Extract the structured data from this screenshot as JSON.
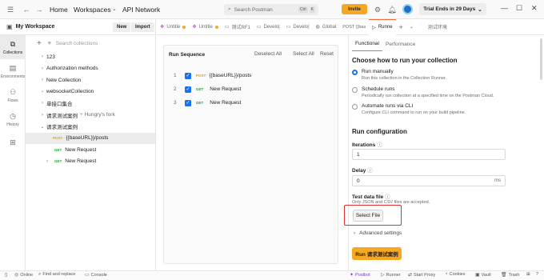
{
  "topbar": {
    "home": "Home",
    "workspaces": "Workspaces",
    "api_network": "API Network",
    "search_placeholder": "Search Postman",
    "kbd_ctrl": "Ctrl",
    "kbd_k": "K",
    "invite": "Invite",
    "trial": "Trial Ends in 29 Days"
  },
  "workspace": {
    "name": "My Workspace",
    "new_label": "New",
    "import_label": "Import"
  },
  "tabs": [
    {
      "label": "Untitle",
      "dirty": true
    },
    {
      "label": "Untitle",
      "dirty": true
    },
    {
      "label": "测试RF1",
      "dirty": false
    },
    {
      "label": "Develo|",
      "dirty": false
    },
    {
      "label": "Develo|",
      "dirty": false
    },
    {
      "label": "Global",
      "dirty": false
    },
    {
      "label": "POST {{bas",
      "dirty": false
    },
    {
      "label": "Runne",
      "dirty": false
    }
  ],
  "tabs_env": "测试环境",
  "rail": [
    "Collections",
    "Environments",
    "Flows",
    "History"
  ],
  "tree": {
    "search_placeholder": "Search collections",
    "items": [
      {
        "label": "123"
      },
      {
        "label": "Authorization methods"
      },
      {
        "label": "New Collection"
      },
      {
        "label": "websocketCollection"
      },
      {
        "label": "单接口集合"
      },
      {
        "label": "请求测试案例",
        "fork": "Hungry's fork"
      },
      {
        "label": "请求测试案例"
      },
      {
        "method": "POST",
        "label": "{{baseURL}}/posts"
      },
      {
        "method": "GET",
        "label": "New Request"
      },
      {
        "method": "GET",
        "label": "New Request"
      }
    ]
  },
  "run_sequence": {
    "title": "Run Sequence",
    "deselect_all": "Deselect All",
    "select_all": "Select All",
    "reset": "Reset",
    "rows": [
      {
        "num": "1",
        "method": "POST",
        "label": "{{baseURL}}/posts"
      },
      {
        "num": "2",
        "method": "GET",
        "label": "New Request"
      },
      {
        "num": "3",
        "method": "GET",
        "label": "New Request"
      }
    ]
  },
  "panel": {
    "tab_functional": "Functional",
    "tab_performance": "Performance",
    "choose_title": "Choose how to run your collection",
    "opt1_title": "Run manually",
    "opt1_desc": "Run this collection in the Collection Runner.",
    "opt2_title": "Schedule runs",
    "opt2_desc": "Periodically run collection at a specified time on the Postman Cloud.",
    "opt3_title": "Automate runs via CLI",
    "opt3_desc": "Configure CLI command to run on your build pipeline.",
    "config_title": "Run configuration",
    "iterations_label": "Iterations",
    "iterations_value": "1",
    "delay_label": "Delay",
    "delay_value": "0",
    "delay_unit": "ms",
    "test_data_label": "Test data file",
    "test_data_hint": "Only JSON and CSV files are accepted.",
    "select_file": "Select File",
    "advanced": "Advanced settings",
    "run_button": "Run 请求测试案例"
  },
  "status": {
    "online": "Online",
    "find_replace": "Find and replace",
    "console": "Console",
    "postbot": "Postbot",
    "runner": "Runner",
    "start_proxy": "Start Proxy",
    "cookies": "Cookies",
    "vault": "Vault",
    "trash": "Trash"
  }
}
